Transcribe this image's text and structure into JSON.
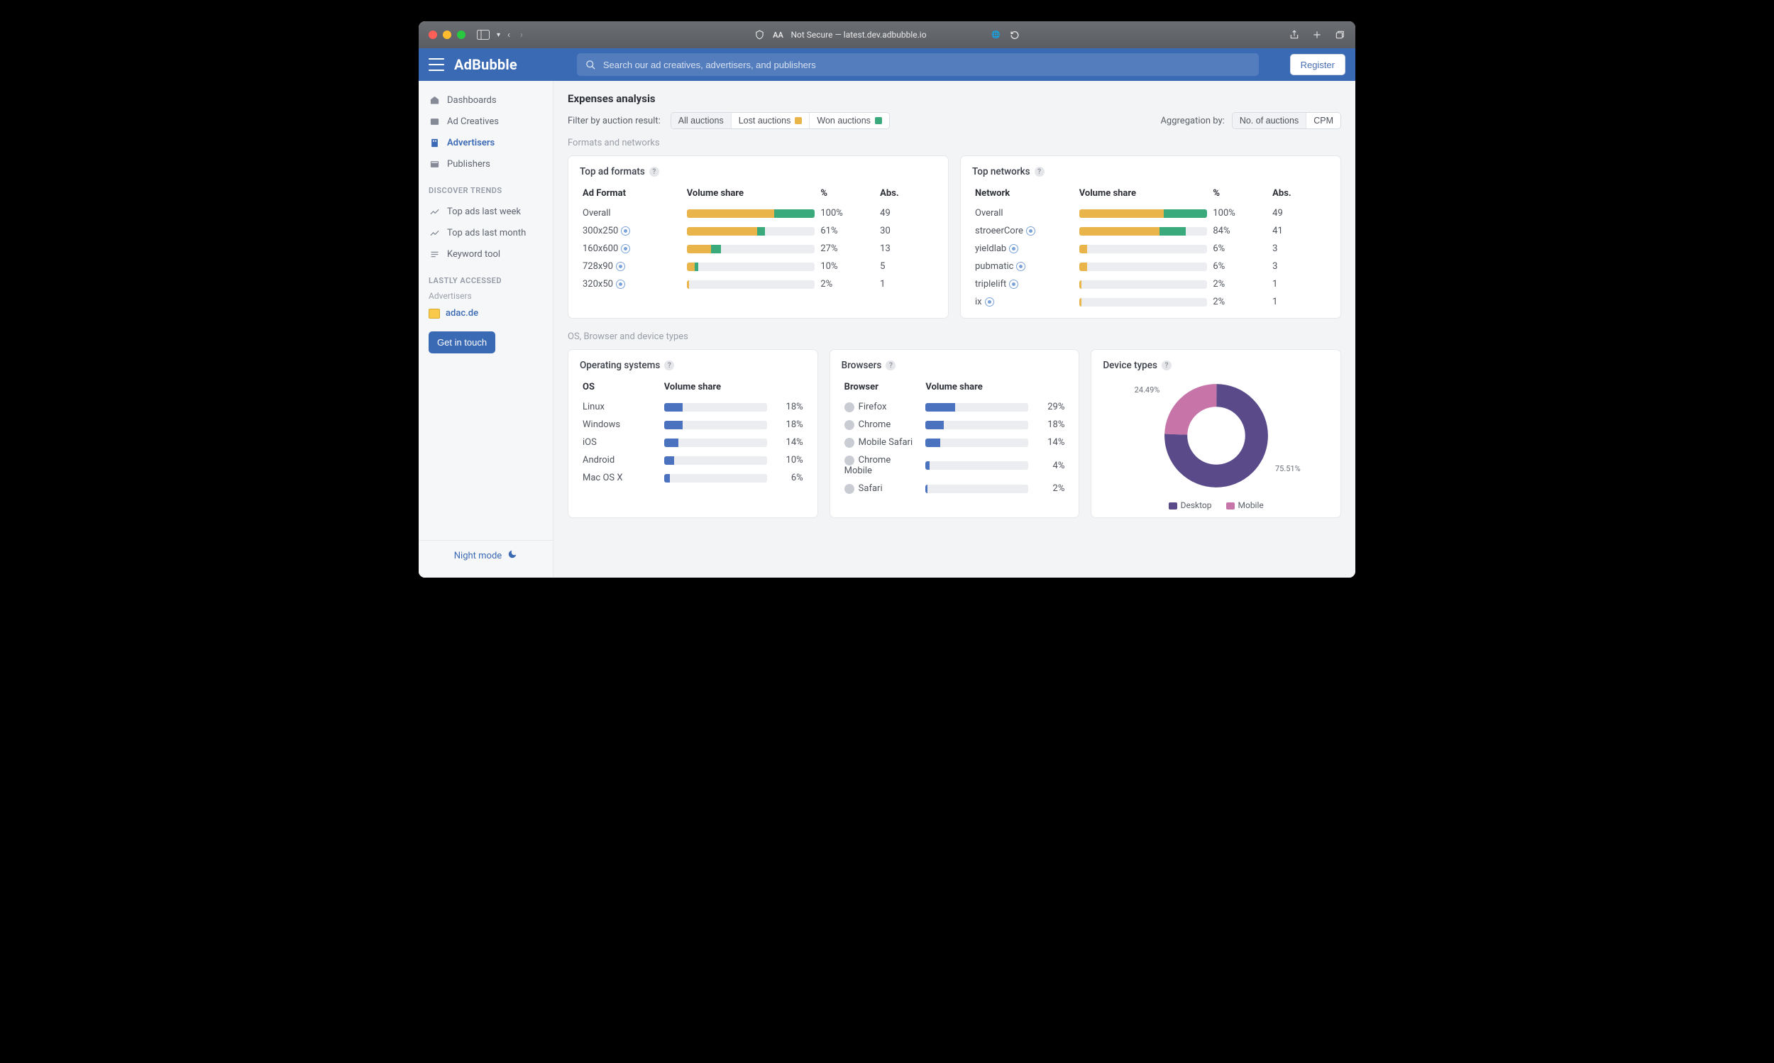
{
  "browser": {
    "url_label": "Not Secure — latest.dev.adbubble.io"
  },
  "header": {
    "logo": "AdBubble",
    "search_placeholder": "Search our ad creatives, advertisers, and publishers",
    "register_label": "Register"
  },
  "sidebar": {
    "nav": [
      {
        "label": "Dashboards"
      },
      {
        "label": "Ad Creatives"
      },
      {
        "label": "Advertisers"
      },
      {
        "label": "Publishers"
      }
    ],
    "trends_title": "DISCOVER TRENDS",
    "trends": [
      {
        "label": "Top ads last week"
      },
      {
        "label": "Top ads last month"
      },
      {
        "label": "Keyword tool"
      }
    ],
    "recent_title": "LASTLY ACCESSED",
    "recent_subtitle": "Advertisers",
    "recent_items": [
      {
        "label": "adac.de"
      }
    ],
    "touch_label": "Get in touch",
    "night_mode": "Night mode"
  },
  "page": {
    "title": "Expenses analysis",
    "filter_label": "Filter by auction result:",
    "filter_opts": [
      "All auctions",
      "Lost auctions",
      "Won auctions"
    ],
    "agg_label": "Aggregation by:",
    "agg_opts": [
      "No. of auctions",
      "CPM"
    ],
    "section1": "Formats and networks",
    "section2": "OS, Browser and device types"
  },
  "formats_card": {
    "title": "Top ad formats",
    "cols": [
      "Ad Format",
      "Volume share",
      "%",
      "Abs."
    ],
    "rows": [
      {
        "name": "Overall",
        "yellow": 68,
        "green": 32,
        "pct": "100%",
        "abs": "49",
        "link": false
      },
      {
        "name": "300x250",
        "yellow": 55,
        "green": 6,
        "pct": "61%",
        "abs": "30",
        "link": true
      },
      {
        "name": "160x600",
        "yellow": 19,
        "green": 8,
        "pct": "27%",
        "abs": "13",
        "link": true
      },
      {
        "name": "728x90",
        "yellow": 6,
        "green": 3,
        "pct": "10%",
        "abs": "5",
        "link": true
      },
      {
        "name": "320x50",
        "yellow": 2,
        "green": 0,
        "pct": "2%",
        "abs": "1",
        "link": true
      }
    ]
  },
  "networks_card": {
    "title": "Top networks",
    "cols": [
      "Network",
      "Volume share",
      "%",
      "Abs."
    ],
    "rows": [
      {
        "name": "Overall",
        "yellow": 66,
        "green": 34,
        "pct": "100%",
        "abs": "49",
        "link": false
      },
      {
        "name": "stroeerCore",
        "yellow": 63,
        "green": 20,
        "pct": "84%",
        "abs": "41",
        "link": true
      },
      {
        "name": "yieldlab",
        "yellow": 6,
        "green": 0,
        "pct": "6%",
        "abs": "3",
        "link": true
      },
      {
        "name": "pubmatic",
        "yellow": 6,
        "green": 0,
        "pct": "6%",
        "abs": "3",
        "link": true
      },
      {
        "name": "triplelift",
        "yellow": 2,
        "green": 0,
        "pct": "2%",
        "abs": "1",
        "link": true
      },
      {
        "name": "ix",
        "yellow": 2,
        "green": 0,
        "pct": "2%",
        "abs": "1",
        "link": true
      }
    ]
  },
  "os_card": {
    "title": "Operating systems",
    "cols": [
      "OS",
      "Volume share",
      ""
    ],
    "rows": [
      {
        "name": "Linux",
        "pct": 18,
        "pct_text": "18%"
      },
      {
        "name": "Windows",
        "pct": 18,
        "pct_text": "18%"
      },
      {
        "name": "iOS",
        "pct": 14,
        "pct_text": "14%"
      },
      {
        "name": "Android",
        "pct": 10,
        "pct_text": "10%"
      },
      {
        "name": "Mac OS X",
        "pct": 6,
        "pct_text": "6%"
      }
    ]
  },
  "browser_card": {
    "title": "Browsers",
    "cols": [
      "Browser",
      "Volume share",
      ""
    ],
    "rows": [
      {
        "name": "Firefox",
        "pct": 29,
        "pct_text": "29%"
      },
      {
        "name": "Chrome",
        "pct": 18,
        "pct_text": "18%"
      },
      {
        "name": "Mobile Safari",
        "pct": 14,
        "pct_text": "14%"
      },
      {
        "name": "Chrome Mobile",
        "pct": 4,
        "pct_text": "4%"
      },
      {
        "name": "Safari",
        "pct": 2,
        "pct_text": "2%"
      }
    ]
  },
  "device_card": {
    "title": "Device types",
    "label_a": "24.49%",
    "label_b": "75.51%",
    "legend": [
      "Desktop",
      "Mobile"
    ],
    "colors": {
      "desktop": "#5b4a8a",
      "mobile": "#c775a8"
    }
  },
  "chart_data": [
    {
      "type": "bar",
      "title": "Top ad formats — volume share",
      "stacked": true,
      "categories": [
        "Overall",
        "300x250",
        "160x600",
        "728x90",
        "320x50"
      ],
      "series": [
        {
          "name": "Lost auctions",
          "values": [
            68,
            55,
            19,
            6,
            2
          ]
        },
        {
          "name": "Won auctions",
          "values": [
            32,
            6,
            8,
            3,
            0
          ]
        }
      ],
      "derived_columns": {
        "%": [
          "100%",
          "61%",
          "27%",
          "10%",
          "2%"
        ],
        "Abs.": [
          49,
          30,
          13,
          5,
          1
        ]
      },
      "xlabel": "Ad Format",
      "ylabel": "Volume share (%)",
      "ylim": [
        0,
        100
      ]
    },
    {
      "type": "bar",
      "title": "Top networks — volume share",
      "stacked": true,
      "categories": [
        "Overall",
        "stroeerCore",
        "yieldlab",
        "pubmatic",
        "triplelift",
        "ix"
      ],
      "series": [
        {
          "name": "Lost auctions",
          "values": [
            66,
            63,
            6,
            6,
            2,
            2
          ]
        },
        {
          "name": "Won auctions",
          "values": [
            34,
            20,
            0,
            0,
            0,
            0
          ]
        }
      ],
      "derived_columns": {
        "%": [
          "100%",
          "84%",
          "6%",
          "6%",
          "2%",
          "2%"
        ],
        "Abs.": [
          49,
          41,
          3,
          3,
          1,
          1
        ]
      },
      "xlabel": "Network",
      "ylabel": "Volume share (%)",
      "ylim": [
        0,
        100
      ]
    },
    {
      "type": "bar",
      "title": "Operating systems — volume share",
      "categories": [
        "Linux",
        "Windows",
        "iOS",
        "Android",
        "Mac OS X"
      ],
      "values": [
        18,
        18,
        14,
        10,
        6
      ],
      "xlabel": "OS",
      "ylabel": "Volume share (%)",
      "ylim": [
        0,
        100
      ]
    },
    {
      "type": "bar",
      "title": "Browsers — volume share",
      "categories": [
        "Firefox",
        "Chrome",
        "Mobile Safari",
        "Chrome Mobile",
        "Safari"
      ],
      "values": [
        29,
        18,
        14,
        4,
        2
      ],
      "xlabel": "Browser",
      "ylabel": "Volume share (%)",
      "ylim": [
        0,
        100
      ]
    },
    {
      "type": "pie",
      "title": "Device types",
      "categories": [
        "Desktop",
        "Mobile"
      ],
      "values": [
        75.51,
        24.49
      ],
      "colors": [
        "#5b4a8a",
        "#c775a8"
      ]
    }
  ]
}
